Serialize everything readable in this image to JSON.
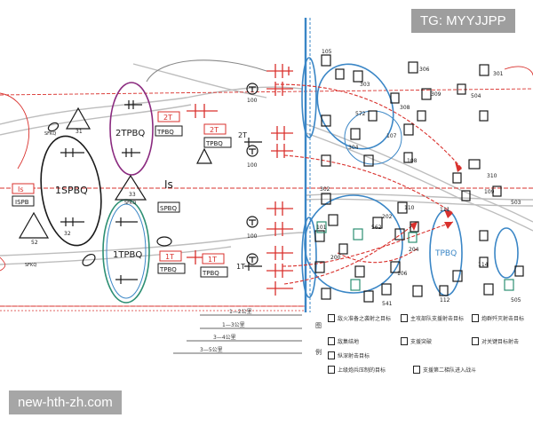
{
  "watermark": {
    "top_right": "TG: MYYJJPP",
    "bottom_left": "new-hth-zh.com"
  },
  "colors": {
    "red": "#d9302c",
    "blue": "#3a86c6",
    "purple": "#8a2a7f",
    "green": "#2d8f73",
    "black": "#1a1a1a",
    "grey": "#bdbdbd"
  },
  "labels": {
    "spbq": "1SPBQ",
    "tpbq2": "2TPBQ",
    "tpbq1": "1TPBQ",
    "tpbq_blue": "TPBQ",
    "is_big": "Is",
    "is_box": "Is",
    "spb_box": "ISPB",
    "t2_box_a": "2T",
    "tpbq_box_a": "TPBQ",
    "t2_box_b": "2T",
    "tpbq_box_b": "TPBQ",
    "t1_box_a": "1T",
    "tpbq_box_c": "TPBQ",
    "t1_box_b": "1T",
    "tpbq_box_d": "TPBQ",
    "spbq_box": "SPBQ",
    "t2_mid": "2T",
    "t1_mid": "1T",
    "sfkq_1": "SFKQ",
    "sfkq_2": "SFKQ",
    "sfkq_3": "SFKQ",
    "n31": "31",
    "n32": "32",
    "n33": "33",
    "n52": "52",
    "n100a": "100",
    "n100b": "100",
    "n100c": "100",
    "n105": "105",
    "n303": "303",
    "n306": "306",
    "n301": "301",
    "n309": "309",
    "n308": "308",
    "n572": "572",
    "n107": "107",
    "n304": "304",
    "n108": "108",
    "n310": "310",
    "n302": "302",
    "n110": "110",
    "n109": "109",
    "n503": "503",
    "n111": "111",
    "n202": "202",
    "n562": "562",
    "n204": "204",
    "n114": "114",
    "n106": "106",
    "n505": "505",
    "n101": "101",
    "n200": "200",
    "n541": "541",
    "n112": "112",
    "n504": "504"
  },
  "scale_bar": [
    "1—2公里",
    "1—3公里",
    "3—4公里",
    "3—5公里"
  ],
  "legend": {
    "header_top": "图",
    "header_bottom": "例",
    "items": [
      "敌火准备之袭射之目标",
      "主攻部队支援射击目标",
      "炮群歼灭射击目标",
      "对关键目标射击",
      "敌集结地",
      "支援突破",
      "纵深射击目标",
      "上级炮兵压制的目标",
      "支援第二梯队进入战斗"
    ]
  }
}
